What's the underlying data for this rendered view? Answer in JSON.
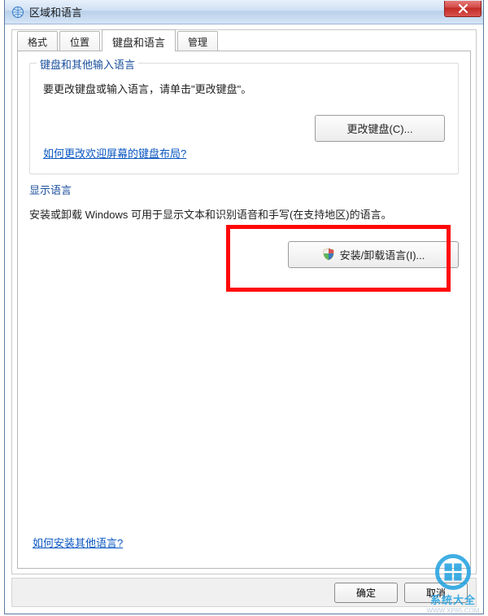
{
  "window": {
    "title": "区域和语言"
  },
  "tabs": [
    {
      "label": "格式"
    },
    {
      "label": "位置"
    },
    {
      "label": "键盘和语言"
    },
    {
      "label": "管理"
    }
  ],
  "keyboard_group": {
    "title": "键盘和其他输入语言",
    "desc": "要更改键盘或输入语言，请单击\"更改键盘\"。",
    "change_btn": "更改键盘(C)...",
    "help_link": "如何更改欢迎屏幕的键盘布局?"
  },
  "display_group": {
    "title": "显示语言",
    "desc": "安装或卸载 Windows 可用于显示文本和识别语音和手写(在支持地区)的语言。",
    "install_btn": "安装/卸载语言(I)..."
  },
  "help_link2": "如何安装其他语言?",
  "buttons": {
    "ok": "确定",
    "cancel": "取消"
  },
  "watermark": {
    "text": "系统大全",
    "url": "WWW.XP85.COM"
  }
}
